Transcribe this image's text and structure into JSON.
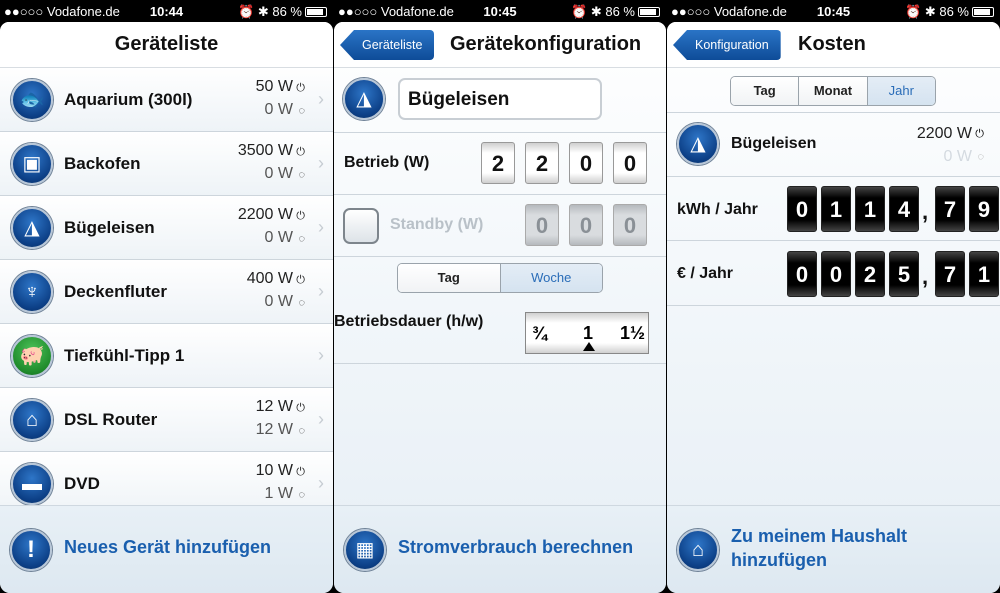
{
  "status": [
    {
      "carrier": "●●○○○ Vodafone.de",
      "time": "10:44",
      "battery": "86 %"
    },
    {
      "carrier": "●●○○○ Vodafone.de",
      "time": "10:45",
      "battery": "86 %"
    },
    {
      "carrier": "●●○○○ Vodafone.de",
      "time": "10:45",
      "battery": "86 %"
    }
  ],
  "screen1": {
    "title": "Geräteliste",
    "rows": [
      {
        "name": "Aquarium (300l)",
        "w1": "50 W",
        "w2": "0 W",
        "icon": "fish-icon"
      },
      {
        "name": "Backofen",
        "w1": "3500 W",
        "w2": "0 W",
        "icon": "oven-icon"
      },
      {
        "name": "Bügeleisen",
        "w1": "2200 W",
        "w2": "0 W",
        "icon": "iron-icon"
      },
      {
        "name": "Deckenfluter",
        "w1": "400 W",
        "w2": "0 W",
        "icon": "lamp-icon"
      },
      {
        "name": "Tiefkühl-Tipp 1",
        "w1": "",
        "w2": "",
        "icon": "piggy-bank-icon"
      },
      {
        "name": "DSL Router",
        "w1": "12 W",
        "w2": "12 W",
        "icon": "router-icon"
      },
      {
        "name": "DVD",
        "w1": "10 W",
        "w2": "1 W",
        "icon": "dvd-icon"
      }
    ],
    "footer": "Neues Gerät hinzufügen"
  },
  "screen2": {
    "back": "Geräteliste",
    "title": "Gerätekonfiguration",
    "device_name": "Bügeleisen",
    "betrieb_label": "Betrieb (W)",
    "betrieb_digits": [
      "2",
      "2",
      "0",
      "0"
    ],
    "standby_label": "Standby (W)",
    "standby_digits": [
      "0",
      "0",
      "0"
    ],
    "segment": [
      "Tag",
      "Woche"
    ],
    "segment_active": "Woche",
    "dauer_label": "Betriebsdauer (h/w)",
    "picker": [
      "¾",
      "1",
      "1½"
    ],
    "footer": "Stromverbrauch berechnen"
  },
  "screen3": {
    "back": "Konfiguration",
    "title": "Kosten",
    "segment": [
      "Tag",
      "Monat",
      "Jahr"
    ],
    "segment_active": "Jahr",
    "device": "Bügeleisen",
    "w1": "2200 W",
    "w2": "0 W",
    "kwh_label": "kWh / Jahr",
    "kwh_digits": [
      "0",
      "1",
      "1",
      "4",
      "7",
      "9"
    ],
    "eur_label": "€ / Jahr",
    "eur_digits": [
      "0",
      "0",
      "2",
      "5",
      "7",
      "1"
    ],
    "footer_line1": "Zu meinem Haushalt",
    "footer_line2": "hinzufügen"
  }
}
